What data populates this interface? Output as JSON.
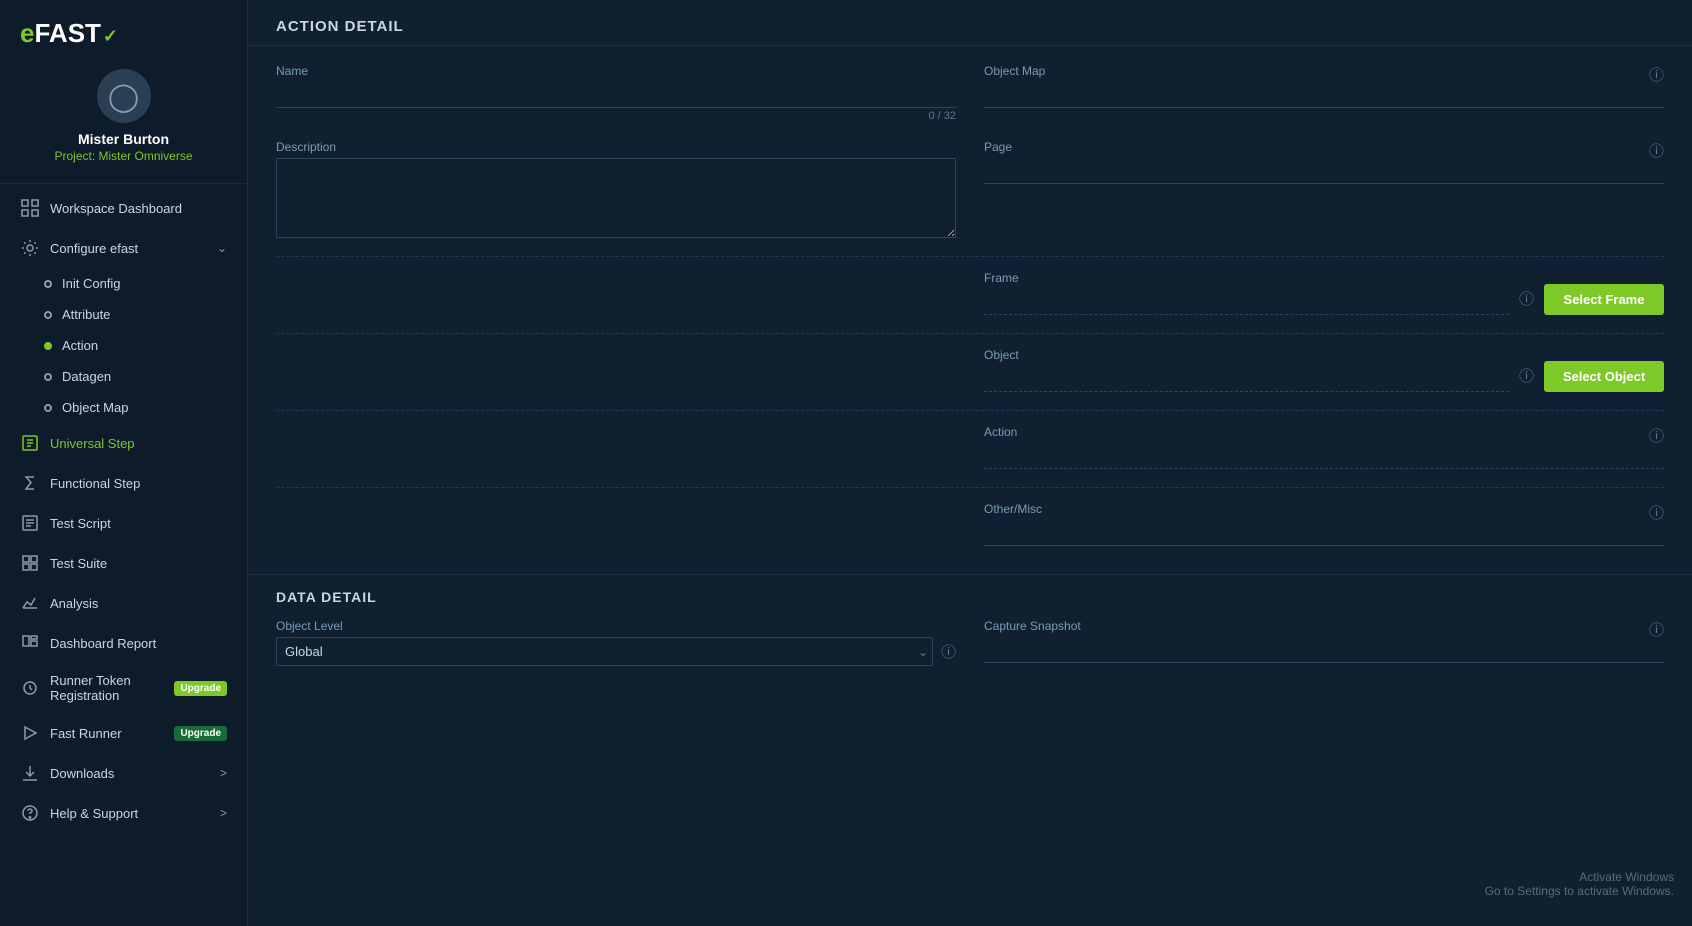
{
  "app": {
    "logo": "eFAST",
    "logo_check": "✓"
  },
  "user": {
    "name": "Mister Burton",
    "project": "Project: Mister Omniverse"
  },
  "sidebar": {
    "items": [
      {
        "id": "workspace-dashboard",
        "label": "Workspace Dashboard",
        "icon": "grid",
        "active": false,
        "expandable": false
      },
      {
        "id": "configure-efast",
        "label": "Configure efast",
        "icon": "gear",
        "active": false,
        "expandable": true,
        "expanded": true
      },
      {
        "id": "init-config",
        "label": "Init Config",
        "icon": "dot",
        "sub": true,
        "active": false
      },
      {
        "id": "attribute",
        "label": "Attribute",
        "icon": "dot",
        "sub": true,
        "active": false
      },
      {
        "id": "action",
        "label": "Action",
        "icon": "dot",
        "sub": true,
        "active": true
      },
      {
        "id": "datagen",
        "label": "Datagen",
        "icon": "dot",
        "sub": true,
        "active": false
      },
      {
        "id": "object-map",
        "label": "Object Map",
        "icon": "dot",
        "sub": true,
        "active": false
      },
      {
        "id": "universal-step",
        "label": "Universal Step",
        "icon": "lightning",
        "active": true
      },
      {
        "id": "functional-step",
        "label": "Functional Step",
        "icon": "sigma",
        "active": false
      },
      {
        "id": "test-script",
        "label": "Test Script",
        "icon": "script",
        "active": false
      },
      {
        "id": "test-suite",
        "label": "Test Suite",
        "icon": "suite",
        "active": false
      },
      {
        "id": "analysis",
        "label": "Analysis",
        "icon": "chart",
        "active": false
      },
      {
        "id": "dashboard-report",
        "label": "Dashboard Report",
        "icon": "dashboard",
        "active": false
      },
      {
        "id": "runner-token",
        "label": "Runner Token Registration",
        "icon": "token",
        "active": false,
        "badge": "Upgrade"
      },
      {
        "id": "fast-runner",
        "label": "Fast Runner",
        "icon": "runner",
        "active": false,
        "badge2": "Upgrade"
      },
      {
        "id": "downloads",
        "label": "Downloads",
        "icon": "download",
        "active": false,
        "expandable": true
      },
      {
        "id": "help-support",
        "label": "Help & Support",
        "icon": "help",
        "active": false,
        "expandable": true
      }
    ]
  },
  "main": {
    "title": "ACTION DETAIL",
    "form": {
      "name_label": "Name",
      "name_value": "",
      "name_char_count": "0 / 32",
      "description_label": "Description",
      "description_value": "",
      "object_map_label": "Object Map",
      "object_map_value": "",
      "page_label": "Page",
      "page_value": "",
      "frame_label": "Frame",
      "frame_value": "",
      "frame_btn": "Select Frame",
      "object_label": "Object",
      "object_value": "",
      "object_btn": "Select Object",
      "action_label": "Action",
      "action_value": "",
      "other_misc_label": "Other/Misc",
      "other_misc_value": ""
    },
    "data_detail": {
      "title": "DATA DETAIL",
      "object_level_label": "Object Level",
      "object_level_value": "Global",
      "capture_snapshot_label": "Capture Snapshot"
    }
  },
  "windows_watermark": {
    "line1": "Activate Windows",
    "line2": "Go to Settings to activate Windows."
  }
}
